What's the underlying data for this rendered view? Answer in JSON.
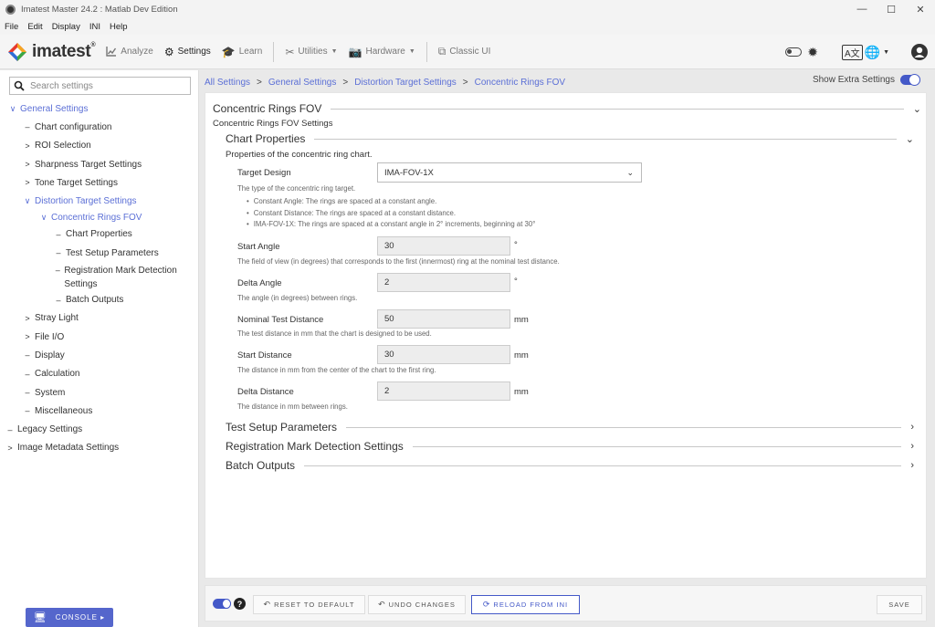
{
  "window": {
    "title": "Imatest Master 24.2 : Matlab Dev Edition",
    "controls": [
      "—",
      "☐",
      "✕"
    ]
  },
  "menu": [
    "File",
    "Edit",
    "Display",
    "INI",
    "Help"
  ],
  "toolbar": {
    "brand": "imatest",
    "brand_mark": "®",
    "analyze": "Analyze",
    "settings": "Settings",
    "learn": "Learn",
    "utilities": "Utilities",
    "hardware": "Hardware",
    "classic": "Classic UI"
  },
  "sidebar": {
    "search_placeholder": "Search settings",
    "items": [
      {
        "label": "General Settings",
        "glyph": "∨"
      },
      {
        "label": "Chart configuration",
        "glyph": "–"
      },
      {
        "label": "ROI Selection",
        "glyph": ">"
      },
      {
        "label": "Sharpness Target Settings",
        "glyph": ">"
      },
      {
        "label": "Tone Target Settings",
        "glyph": ">"
      },
      {
        "label": "Distortion Target Settings",
        "glyph": "∨"
      },
      {
        "label": "Concentric Rings FOV",
        "glyph": "∨"
      },
      {
        "label": "Chart Properties",
        "glyph": "–"
      },
      {
        "label": "Test Setup Parameters",
        "glyph": "–"
      },
      {
        "label": "Registration Mark Detection Settings",
        "glyph": "–"
      },
      {
        "label": "Batch Outputs",
        "glyph": "–"
      },
      {
        "label": "Stray Light",
        "glyph": ">"
      },
      {
        "label": "File I/O",
        "glyph": ">"
      },
      {
        "label": "Display",
        "glyph": "–"
      },
      {
        "label": "Calculation",
        "glyph": "–"
      },
      {
        "label": "System",
        "glyph": "–"
      },
      {
        "label": "Miscellaneous",
        "glyph": "–"
      },
      {
        "label": "Legacy Settings",
        "glyph": "–"
      },
      {
        "label": "Image Metadata Settings",
        "glyph": ">"
      }
    ],
    "console": "CONSOLE ▸"
  },
  "breadcrumb": [
    "All Settings",
    "General Settings",
    "Distortion Target Settings",
    "Concentric Rings FOV"
  ],
  "show_extra_settings": "Show Extra Settings",
  "main": {
    "title": "Concentric Rings FOV",
    "subtitle": "Concentric Rings FOV Settings",
    "chart_props": {
      "title": "Chart Properties",
      "desc": "Properties of the concentric ring chart."
    },
    "target_design": {
      "label": "Target Design",
      "value": "IMA-FOV-1X",
      "desc": "The type of the concentric ring target.",
      "bullets": [
        "Constant Angle: The rings are spaced at a constant angle.",
        "Constant Distance: The rings are spaced at a constant distance.",
        "IMA-FOV-1X: The rings are spaced at a constant angle in 2° increments, beginning at 30°"
      ]
    },
    "start_angle": {
      "label": "Start Angle",
      "value": "30",
      "unit": "°",
      "desc": "The field of view (in degrees) that corresponds to the first (innermost) ring at the nominal test distance."
    },
    "delta_angle": {
      "label": "Delta Angle",
      "value": "2",
      "unit": "°",
      "desc": "The angle (in degrees) between rings."
    },
    "nominal_distance": {
      "label": "Nominal Test Distance",
      "value": "50",
      "unit": "mm",
      "desc": "The test distance in mm that the chart is designed to be used."
    },
    "start_distance": {
      "label": "Start Distance",
      "value": "30",
      "unit": "mm",
      "desc": "The distance in mm from the center of the chart to the first ring."
    },
    "delta_distance": {
      "label": "Delta Distance",
      "value": "2",
      "unit": "mm",
      "desc": "The distance in mm between rings."
    },
    "collapsed": [
      "Test Setup Parameters",
      "Registration Mark Detection Settings",
      "Batch Outputs"
    ]
  },
  "bottom": {
    "help": "?",
    "reset": "RESET TO DEFAULT",
    "undo": "UNDO CHANGES",
    "reload": "RELOAD FROM INI",
    "save": "SAVE"
  },
  "colors": {
    "accent": "#4459c8",
    "link": "#5b6fd6"
  }
}
